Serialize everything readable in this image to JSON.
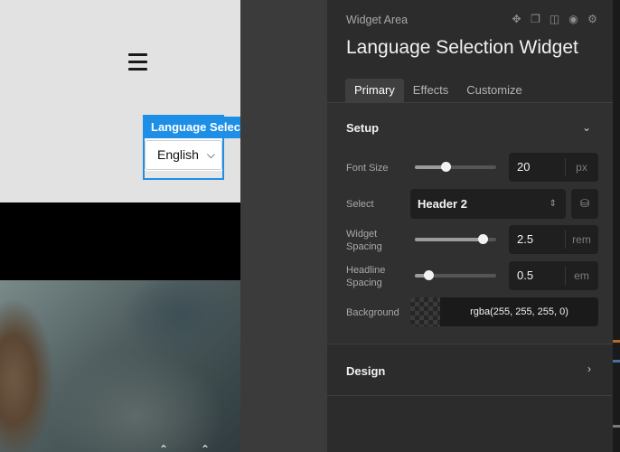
{
  "canvas": {
    "widget_label": "Language Selection",
    "language_value": "English"
  },
  "panel": {
    "breadcrumb": "Widget Area",
    "title": "Language Selection Widget",
    "header_icons": [
      "move-icon",
      "copy-icon",
      "delete-icon",
      "visibility-icon",
      "settings-icon"
    ],
    "tabs": [
      {
        "label": "Primary",
        "active": true
      },
      {
        "label": "Effects",
        "active": false
      },
      {
        "label": "Customize",
        "active": false
      }
    ],
    "setup": {
      "title": "Setup",
      "font_size": {
        "label": "Font Size",
        "value": "20",
        "unit": "px",
        "slider_fraction": 0.38
      },
      "select": {
        "label": "Select",
        "value": "Header 2"
      },
      "widget_spacing": {
        "label": "Widget Spacing",
        "label_line1": "Widget",
        "label_line2": "Spacing",
        "value": "2.5",
        "unit": "rem",
        "slider_fraction": 0.83
      },
      "headline_spacing": {
        "label": "Headline Spacing",
        "label_line1": "Headline",
        "label_line2": "Spacing",
        "value": "0.5",
        "unit": "em",
        "slider_fraction": 0.17
      },
      "background": {
        "label": "Background",
        "value": "rgba(255, 255, 255, 0)"
      }
    },
    "design": {
      "title": "Design"
    }
  },
  "colors": {
    "accent": "#1e8fe6",
    "panel_bg": "#2c2c2c",
    "field_bg": "#1f1f1f"
  }
}
